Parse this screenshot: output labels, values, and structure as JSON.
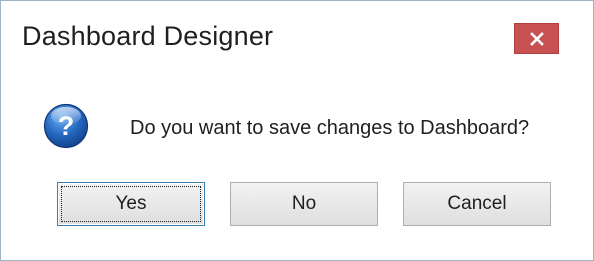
{
  "window": {
    "title": "Dashboard Designer",
    "close_icon": "close-icon"
  },
  "dialog": {
    "icon": "question-icon",
    "message": "Do you want to save changes to Dashboard?",
    "buttons": {
      "yes": "Yes",
      "no": "No",
      "cancel": "Cancel"
    },
    "default_button": "Yes"
  },
  "colors": {
    "close_button": "#c75050",
    "icon_blue": "#1e5fb4",
    "border": "#9fb3c9"
  }
}
